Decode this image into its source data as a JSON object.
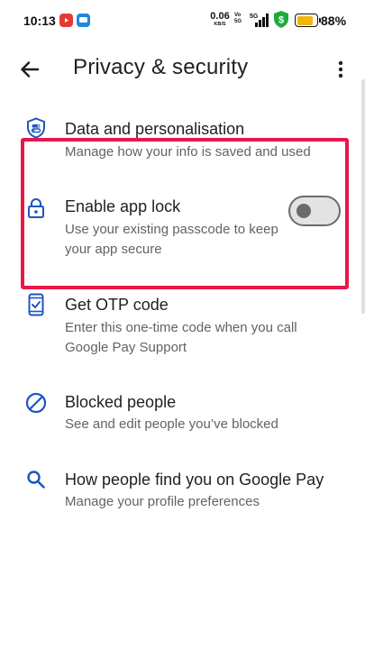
{
  "status_bar": {
    "time": "10:13",
    "net_speed_value": "0.06",
    "net_speed_unit": "KB/S",
    "volte_line1": "Vo",
    "volte_line2": "5G",
    "network_type": "5G",
    "battery_percent": "88%",
    "battery_level": 0.88,
    "battery_color": "#f2b50a"
  },
  "app_bar": {
    "title": "Privacy & security",
    "back_icon": "arrow-left-icon",
    "menu_icon": "more-vert-icon"
  },
  "items": [
    {
      "icon": "shield-toggle-icon",
      "title": "Data and personalisation",
      "subtitle": "Manage how your info is saved and used"
    },
    {
      "icon": "lock-icon",
      "title": "Enable app lock",
      "subtitle": "Use your existing passcode to keep your app secure",
      "toggle_on": false
    },
    {
      "icon": "phone-check-icon",
      "title": "Get OTP code",
      "subtitle": "Enter this one-time code when you call Google Pay Support"
    },
    {
      "icon": "block-icon",
      "title": "Blocked people",
      "subtitle": "See and edit people you’ve blocked"
    },
    {
      "icon": "search-icon",
      "title": "How people find you on Google Pay",
      "subtitle": "Manage your profile preferences"
    }
  ],
  "colors": {
    "icon_blue": "#1a56c4",
    "highlight_red": "#e8174a"
  }
}
